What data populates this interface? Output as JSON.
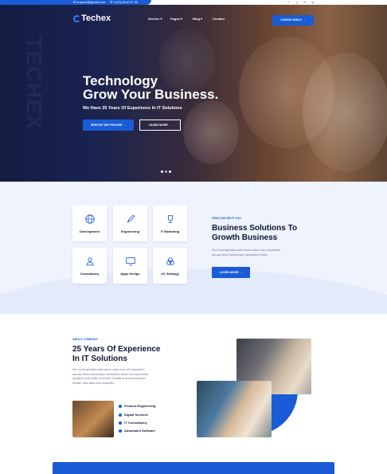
{
  "topbar": {
    "email": "support@gmail.com",
    "phone": "+(10) 2442 47 50",
    "social": [
      "f",
      "y",
      "in",
      "ig"
    ]
  },
  "brand": {
    "name": "Techex",
    "accent": "#1a5cd6"
  },
  "nav": {
    "items": [
      "Service",
      "Pages",
      "Blog",
      "Contact"
    ],
    "cta": "CONSULTANCY →"
  },
  "hero": {
    "watermark": "TECHEX",
    "title_line1": "Technology",
    "title_line2": "Grow Your Business.",
    "subtitle": "We Have 25 Years Of Experience In IT Solutions",
    "primary_btn": "SERVICE WE PROVIDE →",
    "secondary_btn": "LEARN MORE →",
    "slides": 3,
    "active_slide": 1
  },
  "services": {
    "cards": [
      {
        "label": "Development",
        "icon": "globe-icon"
      },
      {
        "label": "Engineering",
        "icon": "rocket-icon"
      },
      {
        "label": "IT Marketing",
        "icon": "trophy-icon"
      },
      {
        "label": "Consultancy",
        "icon": "user-icon"
      },
      {
        "label": "Apps Design",
        "icon": "monitor-icon"
      },
      {
        "label": "UX Strategy",
        "icon": "circles-icon"
      }
    ],
    "tag": "HOW CAN HELP YOU",
    "heading_line1": "Business Solutions To",
    "heading_line2": "Growth Business",
    "text_line1": "Sed ut perspiciatis unde omnis natus error voluptatem",
    "text_line2": "accusa ntium doloremque laudantium totam.",
    "button": "LEARN MORE →"
  },
  "about": {
    "tag": "ABOUT COMPANY",
    "heading_line1": "25 Years Of Experience",
    "heading_line2": "In IT Solutions",
    "text_lines": [
      "Sed ut perspiciatis unde omnis natus error sit voluptatem",
      "accusa ntium doloremque laudantium totam rem aperiamea",
      "queapse quae abillo inventore veritatis et quasi architecto",
      "beatae vitae dicta sunt explicabo."
    ],
    "checklist": [
      "Product Engineering",
      "Digital Services",
      "IT Consultancy",
      "Automated Software"
    ]
  }
}
